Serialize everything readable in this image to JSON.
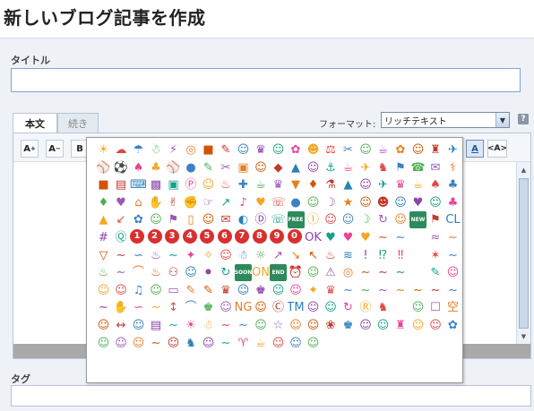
{
  "page": {
    "title": "新しいブログ記事を作成"
  },
  "fields": {
    "title_label": "タイトル",
    "title_value": "",
    "tag_label": "タグ",
    "tag_value": ""
  },
  "editor": {
    "tabs": [
      {
        "label": "本文",
        "active": true
      },
      {
        "label": "続き",
        "active": false
      }
    ],
    "format_label": "フォーマット:",
    "format_value": "リッチテキスト",
    "help_label": "?",
    "toolbar": {
      "font_size_up": "A",
      "font_size_down": "A",
      "bold": "B",
      "text_color": "A",
      "html_toggle": "<A>"
    }
  },
  "emoji_palette": {
    "cells": [
      "☀",
      "☁",
      "☂",
      "☃",
      "⚡",
      "◎",
      "■",
      "✎",
      "☺",
      "♛",
      "☺",
      "✿",
      "☻",
      "⚖",
      "✂",
      "☺",
      "☕",
      "✿",
      "☺",
      "♜",
      "✈",
      "⚾",
      "⚽",
      "♠",
      "♣",
      "⚾",
      "●",
      "✎",
      "✂",
      "▣",
      "☺",
      "◆",
      "▲",
      "☺",
      "⚓",
      "☕",
      "✈",
      "♞",
      "⚑",
      "☎",
      "✉",
      "⚕",
      "■",
      "▤",
      "⌨",
      "▩",
      "▣",
      "Ⓟ",
      "☺",
      "♨",
      "✚",
      "☕",
      "♛",
      "▼",
      "♦",
      "⚗",
      "▲",
      "☺",
      "✈",
      "♛",
      "☕",
      "♠",
      "♣",
      "♦",
      "♥",
      "⌂",
      "✋",
      "✌",
      "✊",
      "☞",
      "↗",
      "♪",
      "♥",
      "☏",
      "●",
      "☺",
      "☽",
      "★",
      "☺",
      "☻",
      "☺",
      "♥",
      "☺",
      "♣",
      "▲",
      "↙",
      "✿",
      "☺",
      "⚑",
      "▯",
      "☺",
      "✉",
      "◐",
      "Ⓓ",
      "☏",
      "FREE",
      "Ⓘ",
      "☺",
      "☺",
      "☽",
      "↻",
      "☺",
      "NEW",
      "⚑",
      "CL",
      "#",
      "Ⓠ",
      "1",
      "2",
      "3",
      "4",
      "5",
      "6",
      "7",
      "8",
      "9",
      "0",
      "OK",
      "♥",
      "♥",
      "♥",
      "∼",
      "∼",
      "",
      "≈",
      "∼",
      "▽",
      "∼",
      "∽",
      "♨",
      "∼",
      "✦",
      "✧",
      "☺",
      "☃",
      "☼",
      "↗",
      "↘",
      "↖",
      "♨",
      "≋",
      "!",
      "⁉",
      "‼",
      "",
      "✶",
      "∼",
      "♨",
      "∼",
      "⌒",
      "♨",
      "⚇",
      "☺",
      "⚫",
      "↻",
      "SOON",
      "ON",
      "END",
      "⏰",
      "☺",
      "⚠",
      "◎",
      "∼",
      "∼",
      "∼",
      "",
      "✎",
      "☺",
      "☺",
      "☺",
      "♫",
      "☺",
      "▭",
      "✎",
      "✎",
      "♛",
      "☺",
      "♚",
      "☺",
      "☺",
      "✦",
      "♛",
      "∼",
      "∼",
      "∼",
      "∼",
      "∼",
      "∼",
      "∼",
      "∼",
      "✋",
      "∽",
      "∼",
      "↕",
      "⌒",
      "♚",
      "☺",
      "NG",
      "☺",
      "Ⓒ",
      "TM",
      "☺",
      "☺",
      "↻",
      "Ⓡ",
      "♞",
      "",
      "☺",
      "☐",
      "空",
      "☺",
      "↔",
      "☺",
      "▤",
      "∼",
      "☀",
      "☃",
      "∼",
      "∼",
      "☺",
      "☆",
      "☺",
      "☺",
      "❀",
      "♚",
      "☺",
      "☺",
      "♜",
      "☺",
      "☺",
      "✿",
      "☺",
      "☺",
      "☺",
      "∼",
      "☺",
      "♞",
      "☺",
      "∼",
      "♈",
      "☕",
      "☺",
      "☺",
      "☺",
      "",
      "",
      "",
      "",
      ""
    ]
  }
}
